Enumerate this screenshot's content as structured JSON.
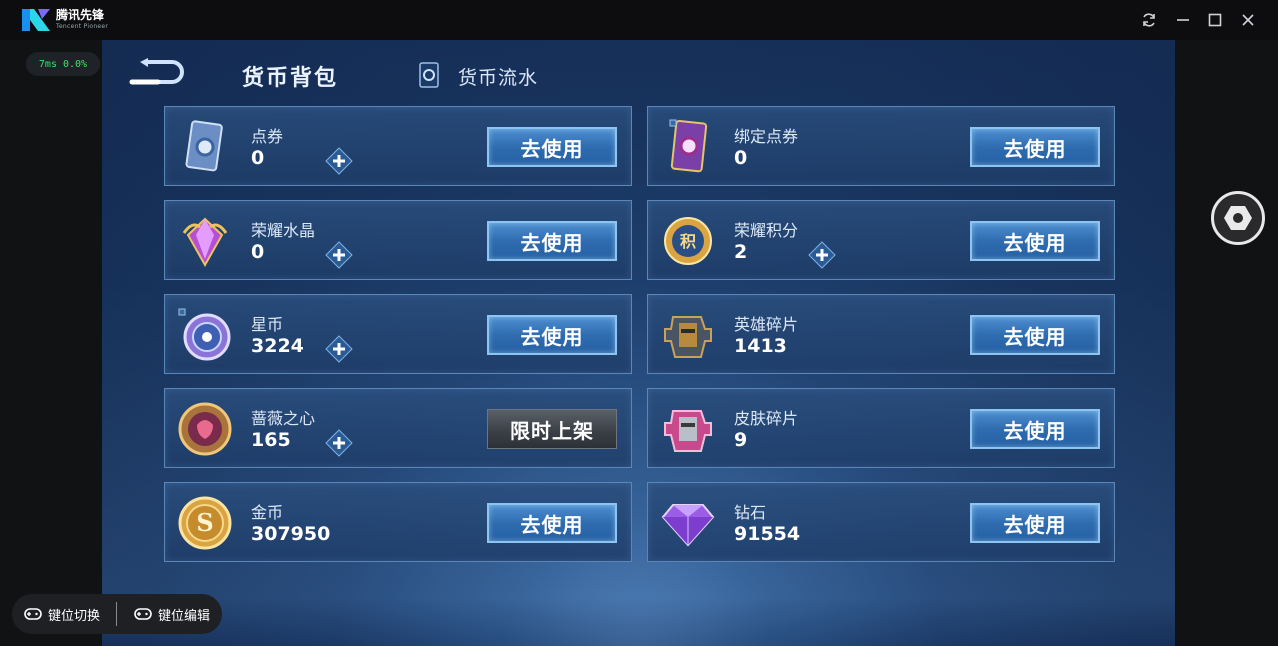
{
  "window": {
    "app_name": "腾讯先锋",
    "app_sub": "Tencent Pioneer",
    "buttons": [
      "refresh-icon",
      "minimize-icon",
      "maximize-icon",
      "close-icon"
    ]
  },
  "perf": "7ms  0.0%",
  "header": {
    "active_tab": "货币背包",
    "flow_tab": "货币流水"
  },
  "currencies": [
    {
      "name": "点券",
      "value": "0",
      "action": "去使用",
      "plus": true
    },
    {
      "name": "绑定点券",
      "value": "0",
      "action": "去使用",
      "plus": false
    },
    {
      "name": "荣耀水晶",
      "value": "0",
      "action": "去使用",
      "plus": true
    },
    {
      "name": "荣耀积分",
      "value": "2",
      "action": "去使用",
      "plus": true
    },
    {
      "name": "星币",
      "value": "3224",
      "action": "去使用",
      "plus": true
    },
    {
      "name": "英雄碎片",
      "value": "1413",
      "action": "去使用",
      "plus": false
    },
    {
      "name": "蔷薇之心",
      "value": "165",
      "action": "限时上架",
      "plus": true
    },
    {
      "name": "皮肤碎片",
      "value": "9",
      "action": "去使用",
      "plus": false
    },
    {
      "name": "金币",
      "value": "307950",
      "action": "去使用",
      "plus": false
    },
    {
      "name": "钻石",
      "value": "91554",
      "action": "去使用",
      "plus": false
    }
  ],
  "keybar": {
    "switch_label": "键位切换",
    "edit_label": "键位编辑"
  },
  "colors": {
    "button_blue": "#2f6cb0",
    "perf_green": "#39e36b",
    "card_border": "#5a86b8"
  }
}
